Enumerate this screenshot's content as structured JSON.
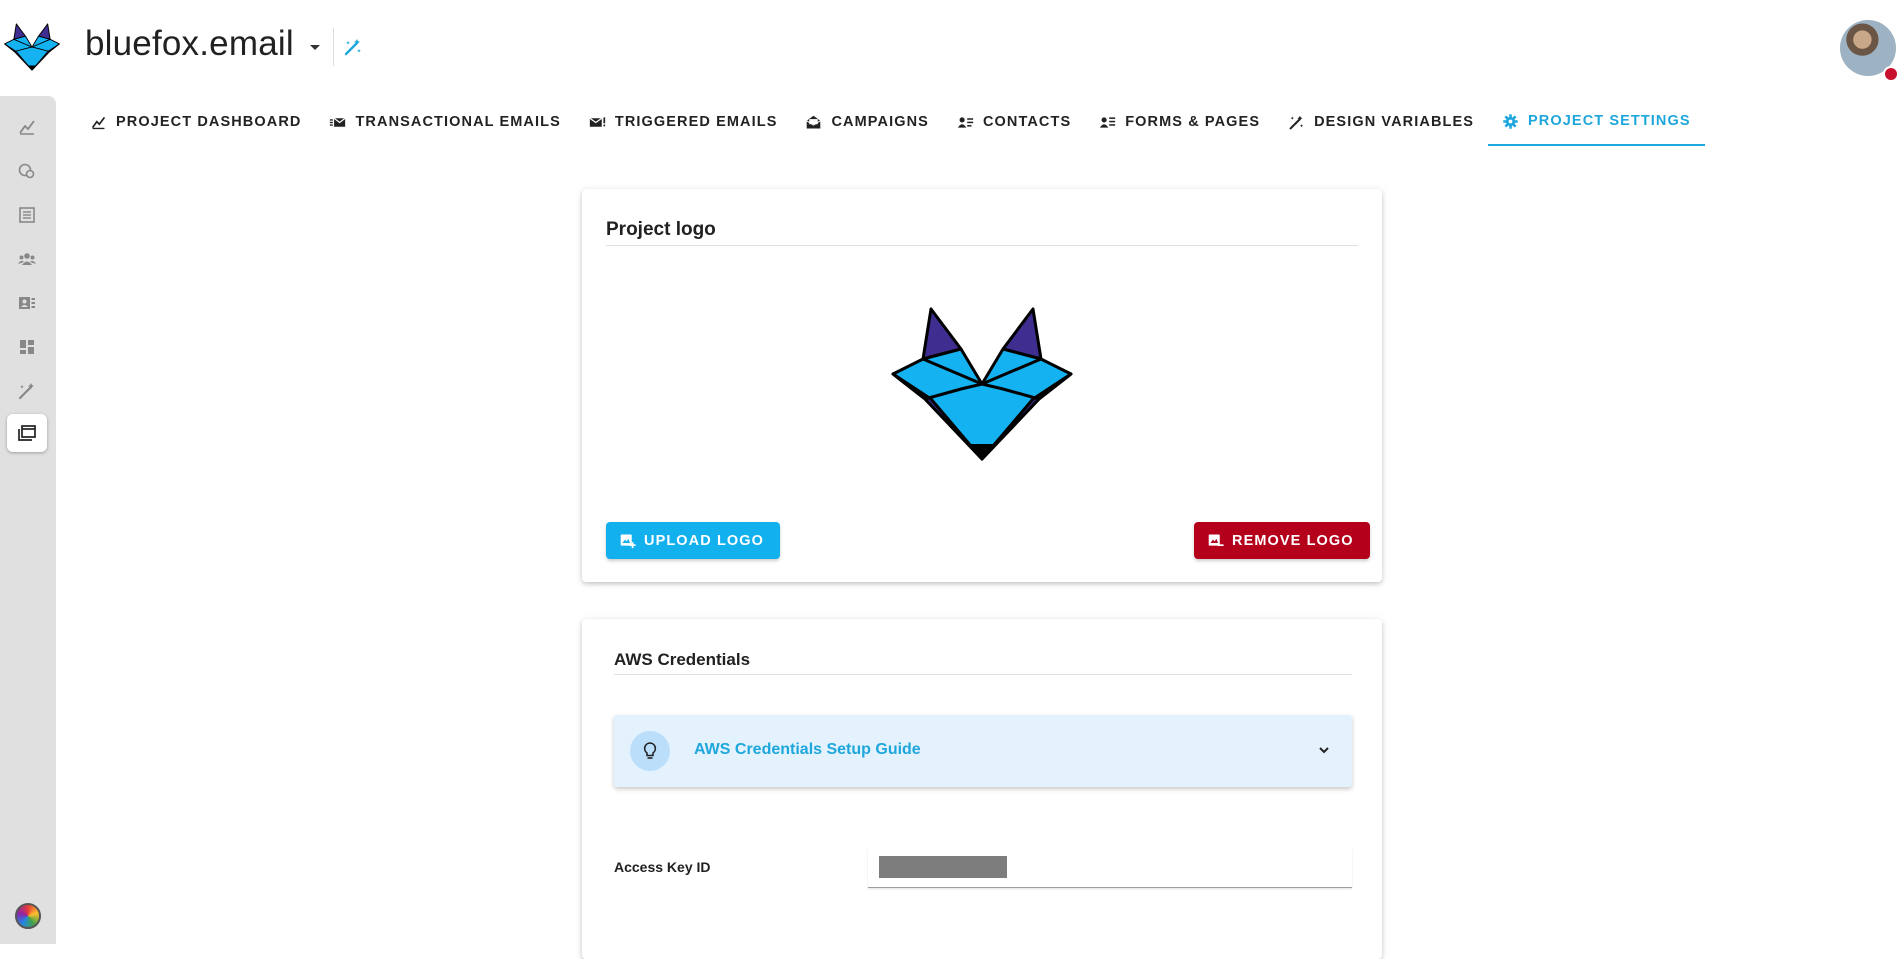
{
  "header": {
    "project_name": "bluefox.email",
    "icons": {
      "brand": "bluefox-logo",
      "caret": "caret-down-icon",
      "action": "design-tools-icon",
      "avatar": "user-avatar"
    }
  },
  "left_rail": {
    "items": [
      {
        "icon": "chart-icon"
      },
      {
        "icon": "bubbles-icon"
      },
      {
        "icon": "list-icon"
      },
      {
        "icon": "people-icon"
      },
      {
        "icon": "id-card-icon"
      },
      {
        "icon": "dashboard-icon"
      },
      {
        "icon": "wand-icon"
      },
      {
        "icon": "folders-icon",
        "active": true
      }
    ]
  },
  "tabs": [
    {
      "label": "PROJECT DASHBOARD",
      "icon": "chart-icon"
    },
    {
      "label": "TRANSACTIONAL EMAILS",
      "icon": "fast-mail-icon"
    },
    {
      "label": "TRIGGERED EMAILS",
      "icon": "mail-alert-icon"
    },
    {
      "label": "CAMPAIGNS",
      "icon": "open-mail-icon"
    },
    {
      "label": "CONTACTS",
      "icon": "contacts-list-icon"
    },
    {
      "label": "FORMS & PAGES",
      "icon": "forms-icon"
    },
    {
      "label": "DESIGN VARIABLES",
      "icon": "wand-icon"
    },
    {
      "label": "PROJECT SETTINGS",
      "icon": "gear-icon",
      "active": true
    }
  ],
  "logo_card": {
    "title": "Project logo",
    "upload_label": "UPLOAD LOGO",
    "remove_label": "REMOVE LOGO"
  },
  "aws_card": {
    "title": "AWS Credentials",
    "guide_title": "AWS Credentials Setup Guide",
    "access_key_label": "Access Key ID",
    "access_key_value": ""
  },
  "colors": {
    "accent": "#1ea7dc",
    "upload_button": "#13b0ee",
    "remove_button": "#b5001c",
    "guide_bg": "#e3f2fd",
    "rail_bg": "#e0e0e0"
  }
}
